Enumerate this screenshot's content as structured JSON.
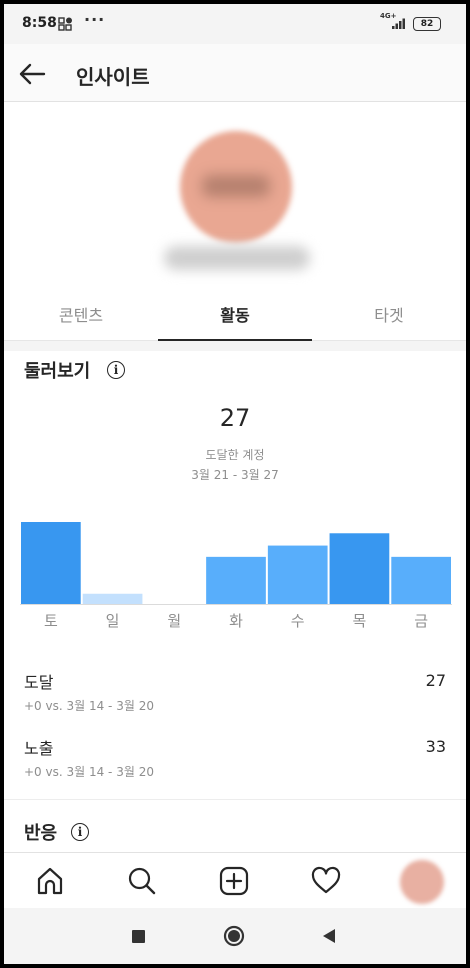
{
  "status_bar": {
    "time": "8:58",
    "more": "···",
    "network": "4G+",
    "battery": "82"
  },
  "header": {
    "title": "인사이트"
  },
  "tabs": [
    {
      "label": "콘텐츠",
      "active": false
    },
    {
      "label": "활동",
      "active": true
    },
    {
      "label": "타겟",
      "active": false
    }
  ],
  "overview": {
    "title": "둘러보기",
    "info_icon_label": "i",
    "total": "27",
    "total_label": "도달한 계정",
    "date_range": "3월 21 - 3월 27"
  },
  "chart_data": {
    "type": "bar",
    "categories": [
      "토",
      "일",
      "월",
      "화",
      "수",
      "목",
      "금"
    ],
    "values": [
      8,
      1,
      0,
      4.6,
      5.7,
      6.9,
      4.6
    ],
    "highlight": [
      true,
      false,
      false,
      false,
      false,
      true,
      false
    ],
    "colors": {
      "highlight": "#3897f0",
      "normal": "#58aefb",
      "low": "#c3e0fd",
      "baseline": "#dbdbdb"
    },
    "ylim": [
      0,
      8
    ]
  },
  "metrics": [
    {
      "label": "도달",
      "value": "27",
      "comparison": "+0 vs. 3월 14 - 3월 20"
    },
    {
      "label": "노출",
      "value": "33",
      "comparison": "+0 vs. 3월 14 - 3월 20"
    }
  ],
  "interactions": {
    "title": "반응",
    "info_icon_label": "i"
  },
  "bottom_nav": [
    "home-icon",
    "search-icon",
    "add-post-icon",
    "heart-icon",
    "profile-avatar"
  ],
  "system_nav": [
    "square-icon",
    "circle-icon",
    "back-triangle-icon"
  ]
}
